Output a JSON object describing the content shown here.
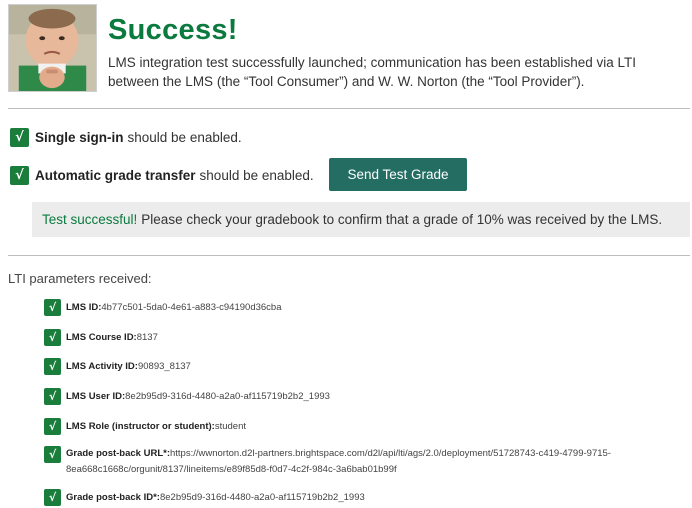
{
  "header": {
    "title": "Success!",
    "description": "LMS integration test successfully launched; communication has been established via LTI between the LMS (the “Tool Consumer”) and W. W. Norton (the “Tool Provider”)."
  },
  "requirements": [
    {
      "label": "Single sign-in",
      "text": "should be enabled."
    },
    {
      "label": "Automatic grade transfer",
      "text": "should be enabled."
    }
  ],
  "send_button": {
    "label": "Send Test Grade"
  },
  "alert": {
    "status": "Test successful!",
    "message": "Please check your gradebook to confirm that a grade of 10% was received by the LMS."
  },
  "params": {
    "heading": "LTI parameters received:",
    "items": [
      {
        "label": "LMS ID:",
        "value": "4b77c501-5da0-4e61-a883-c94190d36cba"
      },
      {
        "label": "LMS Course ID:",
        "value": "8137"
      },
      {
        "label": "LMS Activity ID:",
        "value": "90893_8137"
      },
      {
        "label": "LMS User ID:",
        "value": "8e2b95d9-316d-4480-a2a0-af115719b2b2_1993"
      },
      {
        "label": "LMS Role (instructor or student):",
        "value": "student"
      },
      {
        "label": "Grade post-back URL*:",
        "value": "https://wwnorton.d2l-partners.brightspace.com/d2l/api/lti/ags/2.0/deployment/51728743-c419-4799-9715-8ea668c1668c/orgunit/8137/lineitems/e89f85d8-f0d7-4c2f-984c-3a6bab01b99f"
      },
      {
        "label": "Grade post-back ID*:",
        "value": "8e2b95d9-316d-4480-a2a0-af115719b2b2_1993"
      }
    ]
  },
  "check_glyph": "√",
  "colors": {
    "success_green": "#0b7a3e",
    "check_green": "#1b7d3b",
    "button_teal": "#236d63",
    "alert_bg": "#ececec"
  }
}
